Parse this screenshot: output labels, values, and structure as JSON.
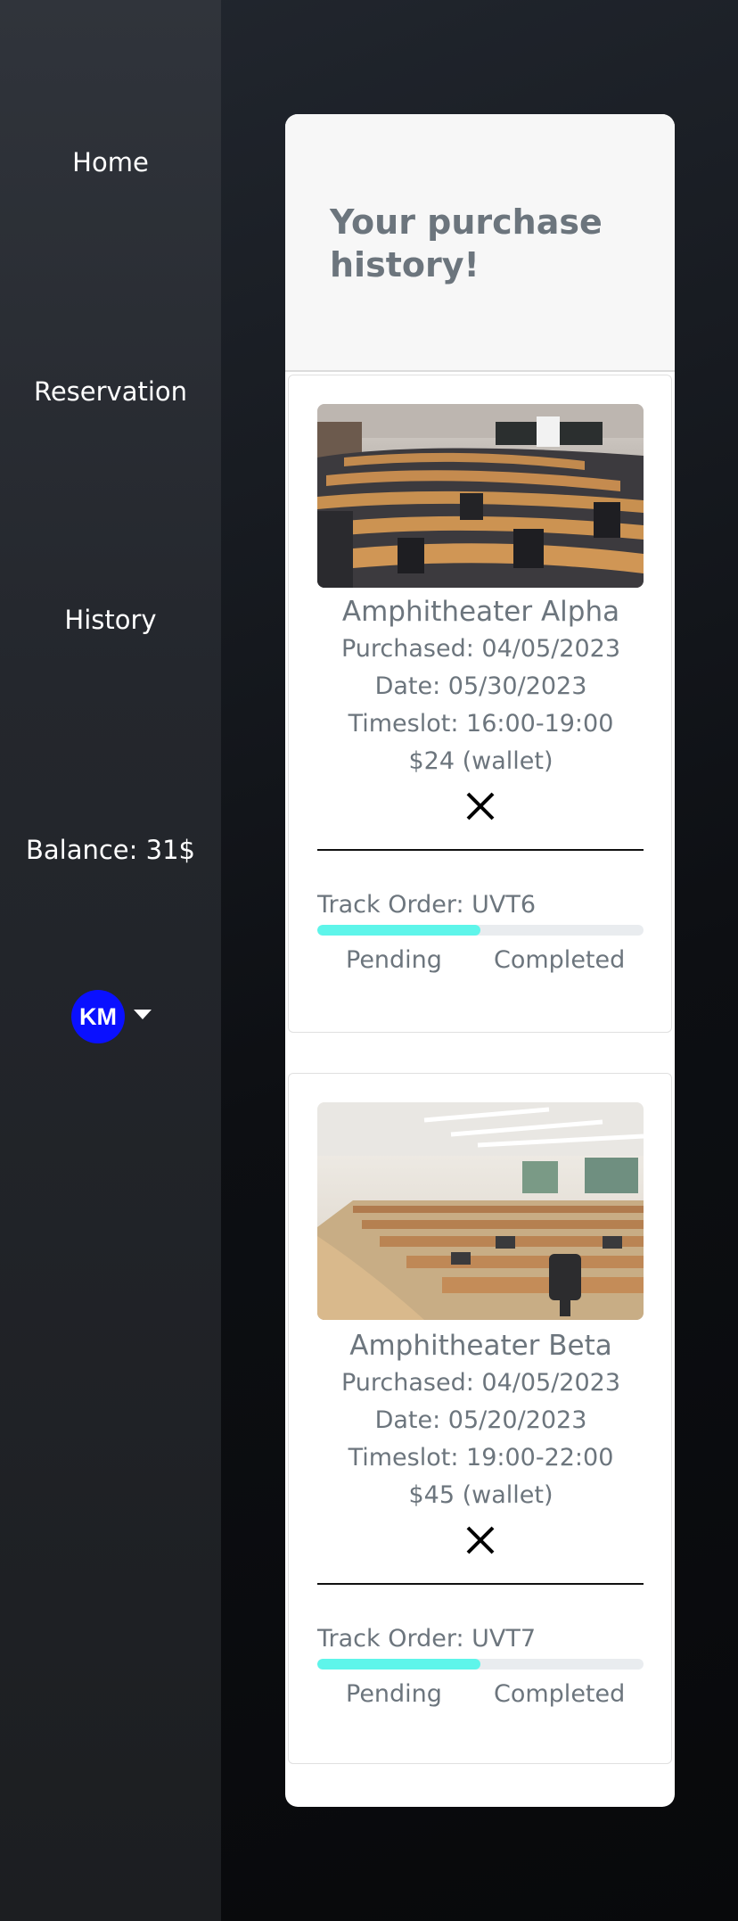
{
  "sidebar": {
    "items": [
      {
        "label": "Home"
      },
      {
        "label": "Reservation"
      },
      {
        "label": "History"
      }
    ],
    "balance": "Balance: 31$",
    "user_initials": "KM"
  },
  "main": {
    "title": "Your purchase history!",
    "orders": [
      {
        "name": "Amphitheater Alpha",
        "purchased": "Purchased: 04/05/2023",
        "date": "Date: 05/30/2023",
        "timeslot": "Timeslot: 16:00-19:00",
        "price": "$24 (wallet)",
        "track": "Track Order: UVT6",
        "progress": 0.5,
        "status_pending": "Pending",
        "status_completed": "Completed"
      },
      {
        "name": "Amphitheater Beta",
        "purchased": "Purchased: 04/05/2023",
        "date": "Date: 05/20/2023",
        "timeslot": "Timeslot: 19:00-22:00",
        "price": "$45 (wallet)",
        "track": "Track Order: UVT7",
        "progress": 0.5,
        "status_pending": "Pending",
        "status_completed": "Completed"
      }
    ]
  },
  "colors": {
    "avatar": "#0a10ff",
    "progress_fill": "#5ef5ea",
    "muted_text": "#6c757d"
  },
  "icons": {
    "cancel": "close-icon",
    "user_menu": "chevron-down-icon"
  }
}
